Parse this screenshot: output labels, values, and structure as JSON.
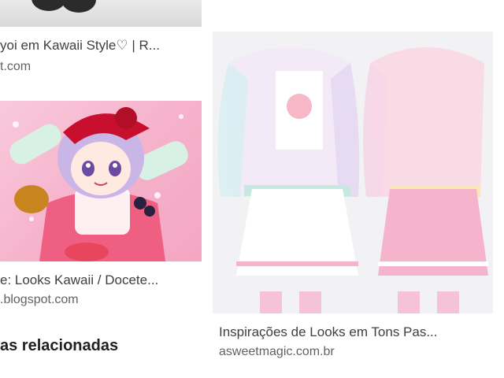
{
  "results": [
    {
      "title": "yoi em Kawaii Style♡ | R...",
      "source": "t.com",
      "image": "shoes-photo"
    },
    {
      "title": "e: Looks Kawaii / Docete...",
      "source": ".blogspot.com",
      "image": "anime-girl-illustration"
    },
    {
      "title": "Inspirações de Looks em Tons Pas...",
      "source": "asweetmagic.com.br",
      "image": "pastel-outfits-photo"
    }
  ],
  "right_top_source": "...",
  "related_heading": "as relacionadas"
}
